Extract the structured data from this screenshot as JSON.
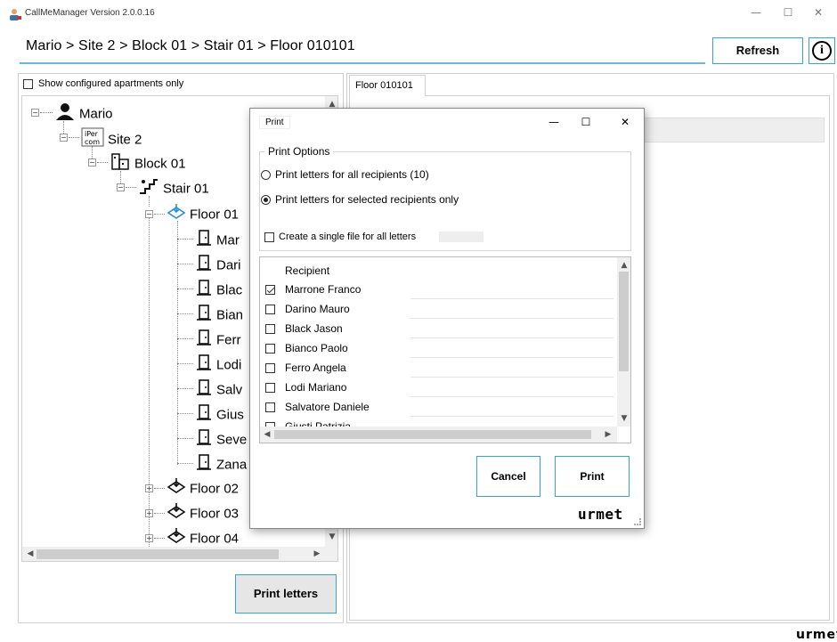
{
  "window": {
    "title": "CallMeManager Version 2.0.0.16",
    "minimize": "—",
    "maximize": "☐",
    "close": "✕"
  },
  "header": {
    "breadcrumb": "Mario > Site 2 > Block 01 > Stair 01 > Floor 010101",
    "refresh_label": "Refresh",
    "info_label": "i"
  },
  "left": {
    "show_configured_label": "Show configured apartments only",
    "show_configured_checked": false,
    "tree": {
      "user": "Mario",
      "site": "Site 2",
      "block": "Block 01",
      "stair": "Stair 01",
      "floor_selected": "Floor 01",
      "apartments": [
        "Mar",
        "Dari",
        "Blac",
        "Bian",
        "Ferr",
        "Lodi",
        "Salv",
        "Gius",
        "Seve",
        "Zana"
      ],
      "floors_other": [
        "Floor 02",
        "Floor 03",
        "Floor 04"
      ]
    },
    "print_letters_label": "Print letters"
  },
  "right": {
    "tab_label": "Floor 010101"
  },
  "dialog": {
    "title": "Print",
    "minimize": "—",
    "maximize": "☐",
    "close": "✕",
    "group_label": "Print Options",
    "opt_all": "Print letters for all recipients (10)",
    "opt_selected": "Print letters for selected recipients only",
    "selected_option": "selected",
    "single_file_label": "Create a single file for all letters",
    "single_file_checked": false,
    "list_header": "Recipient",
    "recipients": [
      {
        "name": "Marrone Franco",
        "checked": true
      },
      {
        "name": "Darino Mauro",
        "checked": false
      },
      {
        "name": "Black Jason",
        "checked": false
      },
      {
        "name": "Bianco Paolo",
        "checked": false
      },
      {
        "name": "Ferro Angela",
        "checked": false
      },
      {
        "name": "Lodi Mariano",
        "checked": false
      },
      {
        "name": "Salvatore Daniele",
        "checked": false
      },
      {
        "name": "Giusti Patrizia",
        "checked": false
      }
    ],
    "cancel_label": "Cancel",
    "print_label": "Print",
    "brand": "urmet"
  },
  "footer": {
    "brand": "urmet"
  },
  "colors": {
    "accent": "#3aa3c8",
    "underline": "#6fb7d6"
  }
}
